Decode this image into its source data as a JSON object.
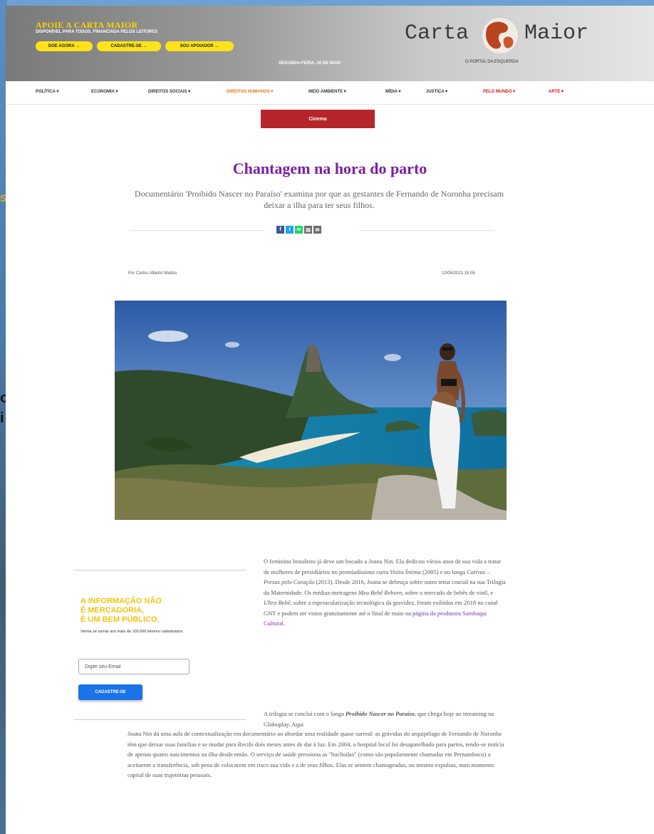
{
  "background_snippets": {
    "left_1": "S",
    "left_2": "o\ni"
  },
  "header": {
    "apoie_title": "APOIE A CARTA MAIOR",
    "apoie_subtitle": "DISPONÍVEL PARA TODOS, FINANCIADA PELOS LEITORES",
    "buttons": [
      {
        "label": "DOE AGORA →"
      },
      {
        "label": "CADASTRE-SE →"
      },
      {
        "label": "SOU APOIADOR →"
      }
    ],
    "date": "SEGUNDA-FEIRA, 10 DE MAIO",
    "logo_left": "Carta",
    "logo_right": "Maior",
    "logo_subtitle": "O PORTAL DA ESQUERDA"
  },
  "nav": {
    "items": [
      {
        "label": "POLÍTICA▼"
      },
      {
        "label": "ECONOMIA▼"
      },
      {
        "label": "DIREITOS SOCIAIS▼"
      },
      {
        "label": "DIREITOS HUMANOS▼"
      },
      {
        "label": "MEIO AMBIENTE▼"
      },
      {
        "label": "MÍDIA▼"
      },
      {
        "label": "JUSTIÇA▼"
      },
      {
        "label": "PELO MUNDO▼"
      },
      {
        "label": "ARTE▼"
      }
    ]
  },
  "article": {
    "category": "Cinema",
    "headline": "Chantagem na hora do parto",
    "subtitle": "Documentário 'Proibido Nascer no Paraíso' examina por que as gestantes de Fernando de Noronha precisam deixar a ilha para ter seus filhos.",
    "share_buttons": [
      {
        "icon": "facebook-icon",
        "glyph": "f",
        "color": "#3b5998"
      },
      {
        "icon": "twitter-icon",
        "glyph": "t",
        "color": "#1da1f2"
      },
      {
        "icon": "whatsapp-icon",
        "glyph": "w",
        "color": "#25d366"
      },
      {
        "icon": "print-icon",
        "glyph": "▤",
        "color": "#6d6d6d"
      },
      {
        "icon": "email-icon",
        "glyph": "✉",
        "color": "#6d6d6d"
      }
    ],
    "byline": "Por Carlos Alberto Mattos",
    "date": "10/05/2021 15:08",
    "p1_before": "O feminino brasileiro já deve um bocado a Joana Nin. Ela dedicou vários anos de sua vida a tratar de mulheres de presidiários no premiadíssimo curta ",
    "p1_em1": "Visita Íntima",
    "p1_mid1": " (2005) e no longa ",
    "p1_em2": "Cativas – Presas pelo Coração",
    "p1_mid2": " (2013). Desde 2016, Joana se debruça sobre outro tema crucial na sua Trilogia da Maternidade. Os médias-metragens ",
    "p1_em3": "Meu Bebê Reborn",
    "p1_mid3": ", sobre o mercado de bebês de vinil, e ",
    "p1_em4": "Ultra Bebê",
    "p1_mid4": ", sobre a espetacularização tecnológica da gravidez, foram exibidos em 2018 no canal GNT e podem ser vistos gratuitamente até o final de maio na ",
    "p1_link": "página da produtora Sambaqui Cultural",
    "p1_end": ".",
    "p2_before": "A trilogia se conclui com o longa ",
    "p2_bold": "Proibido Nascer no Paraíso",
    "p2_after": ", que chega hoje ao streaming na Globoplay. Aqui",
    "p3": "Joana Nin dá uma aula de contextualização em documentário ao abordar uma realidade quase surreal: as grávidas do arquipélago de Fernando de Noronha têm que deixar suas famílias e se mudar para Recife dois meses antes de dar à luz. Em 2004, o hospital local foi desaparelhado para partos, tendo-se notícia de apenas quatro nascimentos na ilha desde então. O serviço de saúde pressiona as \"buchudas\" (como são popularmente chamadas em Pernambuco) a aceitarem a transferência, sob pena de colocarem em risco sua vida e a de seus filhos. Elas se sentem chantageadas, ou mesmo expulsas, num momento capital de suas trajetórias pessoais."
  },
  "sidebar": {
    "title_lines": [
      "A INFORMAÇÃO NÃO",
      "É MERCADORIA,",
      "É UM BEM PÚBLICO."
    ],
    "subtitle": "Venha se somar aos mais de 100.000 leitores cadastrados.",
    "email_placeholder": "Digite seu Email",
    "signup_label": "CADASTRE-SE"
  }
}
